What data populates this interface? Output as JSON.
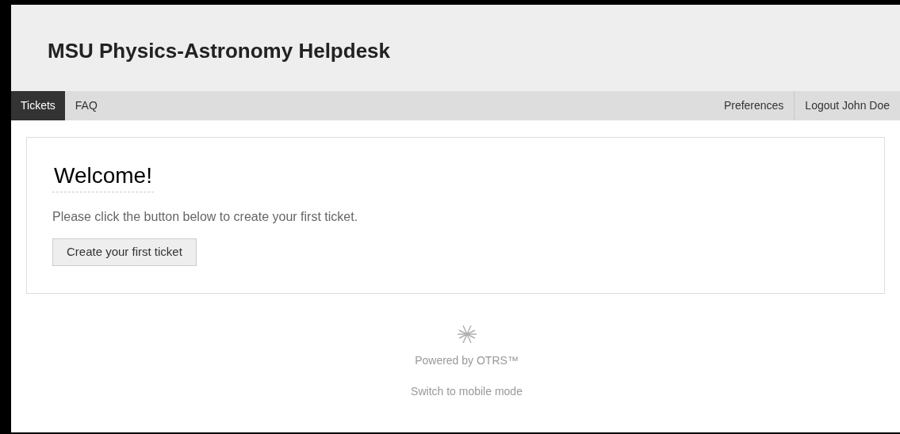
{
  "header": {
    "title": "MSU Physics-Astronomy Helpdesk"
  },
  "nav": {
    "left": [
      {
        "label": "Tickets",
        "selected": true
      },
      {
        "label": "FAQ",
        "selected": false
      }
    ],
    "right": [
      {
        "label": "Preferences"
      },
      {
        "label": "Logout John Doe"
      }
    ]
  },
  "welcome": {
    "heading": "Welcome!",
    "message": "Please click the button below to create your first ticket.",
    "button": "Create your first ticket"
  },
  "footer": {
    "powered": "Powered by OTRS™",
    "mobile_link": "Switch to mobile mode"
  }
}
